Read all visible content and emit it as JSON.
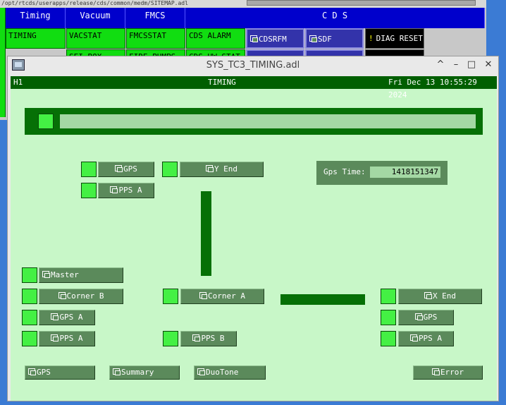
{
  "background_window": {
    "title_text": "/opt/rtcds/userapps/release/cds/common/medm/SITEMAP.adl",
    "headers": [
      "Timing",
      "Vacuum",
      "FMCS",
      "C D S"
    ],
    "row1": [
      "TIMING",
      "VACSTAT",
      "FMCSSTAT",
      "CDS ALARM"
    ],
    "row2": [
      "SEI BOX",
      "FIRE PUMPS",
      "CDS HW STAT"
    ],
    "blue_buttons": [
      "CDSRFM",
      "SDF"
    ],
    "diag_reset": "DIAG RESET",
    "diag_glyph": "!"
  },
  "window": {
    "title": "SYS_TC3_TIMING.adl",
    "controls": [
      "^",
      "–",
      "□",
      "✕"
    ]
  },
  "screen": {
    "header_left": "H1",
    "header_center": "TIMING",
    "header_right": "Fri Dec 13 10:55:29 2024",
    "gps_label": "Gps Time:",
    "gps_value": "1418151347",
    "buttons": {
      "gps_top": "GPS",
      "y_end": "Y End",
      "pps_a_top": "PPS A",
      "master": "Master",
      "corner_b": "Corner B",
      "gps_a": "GPS A",
      "pps_a_left": "PPS A",
      "corner_a": "Corner A",
      "pps_b": "PPS B",
      "x_end": "X End",
      "gps_right": "GPS",
      "pps_a_right": "PPS A",
      "bottom_gps": "GPS",
      "summary": "Summary",
      "duotone": "DuoTone",
      "error": "Error"
    }
  },
  "colors": {
    "panel_bg": "#c8f7c8",
    "indicator": "#44f044",
    "dark_green": "#005f00",
    "button": "#5b8a5b"
  }
}
